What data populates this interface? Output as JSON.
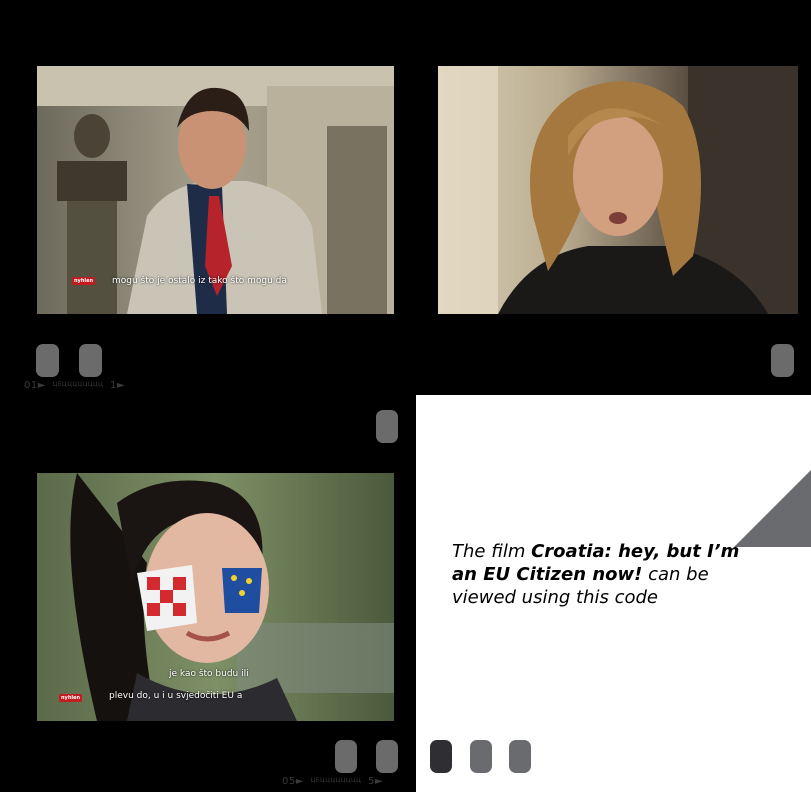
{
  "frames": {
    "top_left": {
      "subtitle": "mogu što je ostalo iz tako što mogu da",
      "logo": "nyhlen"
    },
    "top_right": {},
    "bottom_left": {
      "subtitle_line1": "je kao što budu ili",
      "subtitle_line2": "plevu do, u i u svjedočiti EU a",
      "logo": "nyhlen"
    }
  },
  "counters": {
    "top": {
      "start": "01►",
      "tiny": "ЦЕЦЦЦЦЦЦЦЦ",
      "end": "1►"
    },
    "bottom": {
      "start": "05►",
      "tiny": "ЦЕЦЦЦЦЦЦЦЦ",
      "end": "5►"
    }
  },
  "caption": {
    "prefix": "The film ",
    "bold": "Croatia: hey, but I’m an EU Citizen now!",
    "suffix": " can be viewed using this code"
  },
  "colors": {
    "background": "#000000",
    "panel": "#ffffff",
    "sprocket": "#6b6b6b",
    "triangle": "#6a6b6f"
  }
}
